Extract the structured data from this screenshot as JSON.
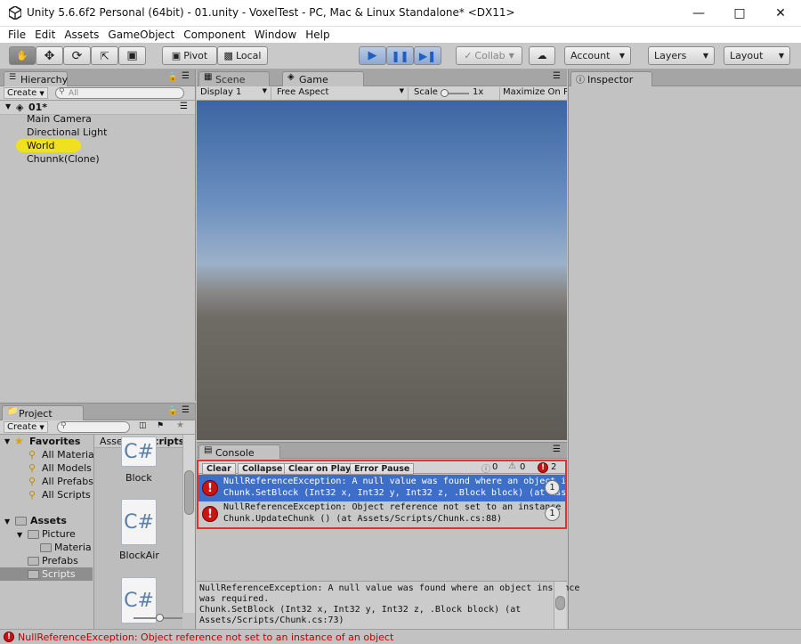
{
  "window": {
    "title": "Unity 5.6.6f2 Personal (64bit) - 01.unity - VoxelTest - PC, Mac & Linux Standalone* <DX11>"
  },
  "menu": [
    "File",
    "Edit",
    "Assets",
    "GameObject",
    "Component",
    "Window",
    "Help"
  ],
  "toolbar": {
    "pivot": "Pivot",
    "local": "Local",
    "collab": "Collab",
    "account": "Account",
    "layers": "Layers",
    "layout": "Layout"
  },
  "hierarchy": {
    "tab": "Hierarchy",
    "create": "Create",
    "search_placeholder": "All",
    "scene": "01*",
    "items": [
      "Main Camera",
      "Directional Light",
      "World",
      "Chunnk(Clone)"
    ]
  },
  "sceneview": {
    "tab_scene": "Scene",
    "tab_game": "Game",
    "display": "Display 1",
    "aspect": "Free Aspect",
    "scale_label": "Scale",
    "scale_value": "1x",
    "maximize": "Maximize On P"
  },
  "inspector": {
    "tab": "Inspector"
  },
  "project": {
    "tab": "Project",
    "create": "Create",
    "favorites_label": "Favorites",
    "favorites": [
      "All Materia",
      "All Models",
      "All Prefabs",
      "All Scripts"
    ],
    "assets_label": "Assets",
    "tree": [
      "Picture",
      "Materials",
      "Prefabs",
      "Scripts"
    ],
    "breadcrumb_root": "Assets",
    "breadcrumb_current": "Scripts",
    "files": [
      "Block",
      "BlockAir"
    ]
  },
  "console": {
    "tab": "Console",
    "buttons": [
      "Clear",
      "Collapse",
      "Clear on Play",
      "Error Pause"
    ],
    "info_count": "0",
    "warn_count": "0",
    "error_count": "2",
    "entries": [
      {
        "line1": "NullReferenceException: A null value was found where an object in",
        "line2": "Chunk.SetBlock (Int32 x, Int32 y, Int32 z, .Block block) (at Assets/Scri",
        "count": "1"
      },
      {
        "line1": "NullReferenceException: Object reference not set to an instance of a",
        "line2": "Chunk.UpdateChunk () (at Assets/Scripts/Chunk.cs:88)",
        "count": "1"
      }
    ],
    "detail": [
      "NullReferenceException: A null value was found where an object instance",
      "was required.",
      "Chunk.SetBlock (Int32 x, Int32 y, Int32 z, .Block block) (at",
      "Assets/Scripts/Chunk.cs:73)"
    ]
  },
  "statusbar": {
    "message": "NullReferenceException: Object reference not set to an instance of an object"
  },
  "colors": {
    "selection": "#3d6fc8",
    "error": "#c91414",
    "highlight": "#f0e020",
    "outline": "#e03030"
  }
}
